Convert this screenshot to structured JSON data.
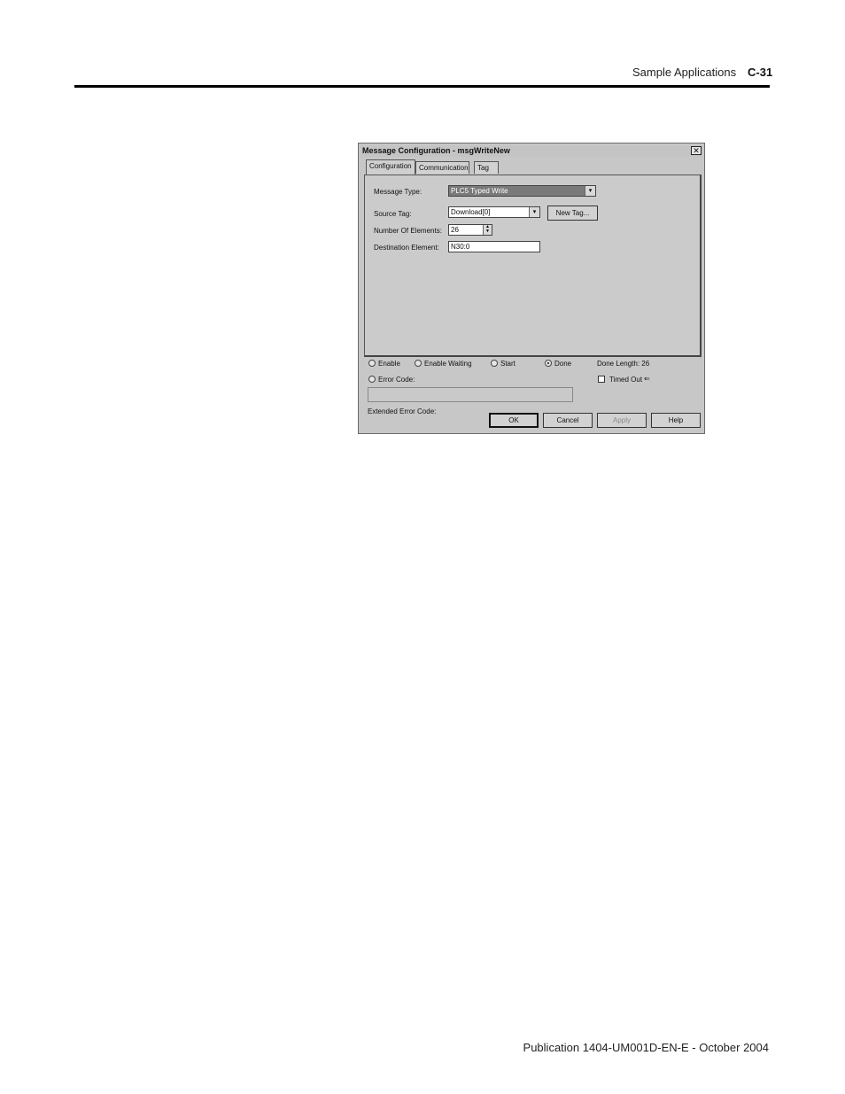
{
  "page": {
    "section_title": "Sample Applications",
    "page_number": "C-31",
    "footer": "Publication 1404-UM001D-EN-E - October 2004"
  },
  "dialog": {
    "title": "Message Configuration - msgWriteNew",
    "close_glyph": "✕",
    "tabs": [
      "Configuration",
      "Communication",
      "Tag"
    ],
    "active_tab": "Configuration",
    "fields": {
      "message_type_label": "Message Type:",
      "message_type_value": "PLC5 Typed Write",
      "source_tag_label": "Source Tag:",
      "source_tag_value": "Download[0]",
      "new_tag_button": "New Tag...",
      "num_elements_label": "Number Of Elements:",
      "num_elements_value": "26",
      "dest_element_label": "Destination Element:",
      "dest_element_value": "N30:0"
    },
    "status": {
      "enable": "Enable",
      "enable_waiting": "Enable Waiting",
      "start": "Start",
      "done": "Done",
      "done_selected": true,
      "done_length": "Done Length: 26",
      "error_code": "Error Code:",
      "timed_out": "Timed Out",
      "timed_out_checked": false,
      "timed_out_arrow": "⇐",
      "extended_error_code": "Extended Error Code:"
    },
    "buttons": {
      "ok": "OK",
      "cancel": "Cancel",
      "apply": "Apply",
      "help": "Help"
    },
    "dropdown_arrow": "▾",
    "spin_up": "▲",
    "spin_down": "▼"
  }
}
